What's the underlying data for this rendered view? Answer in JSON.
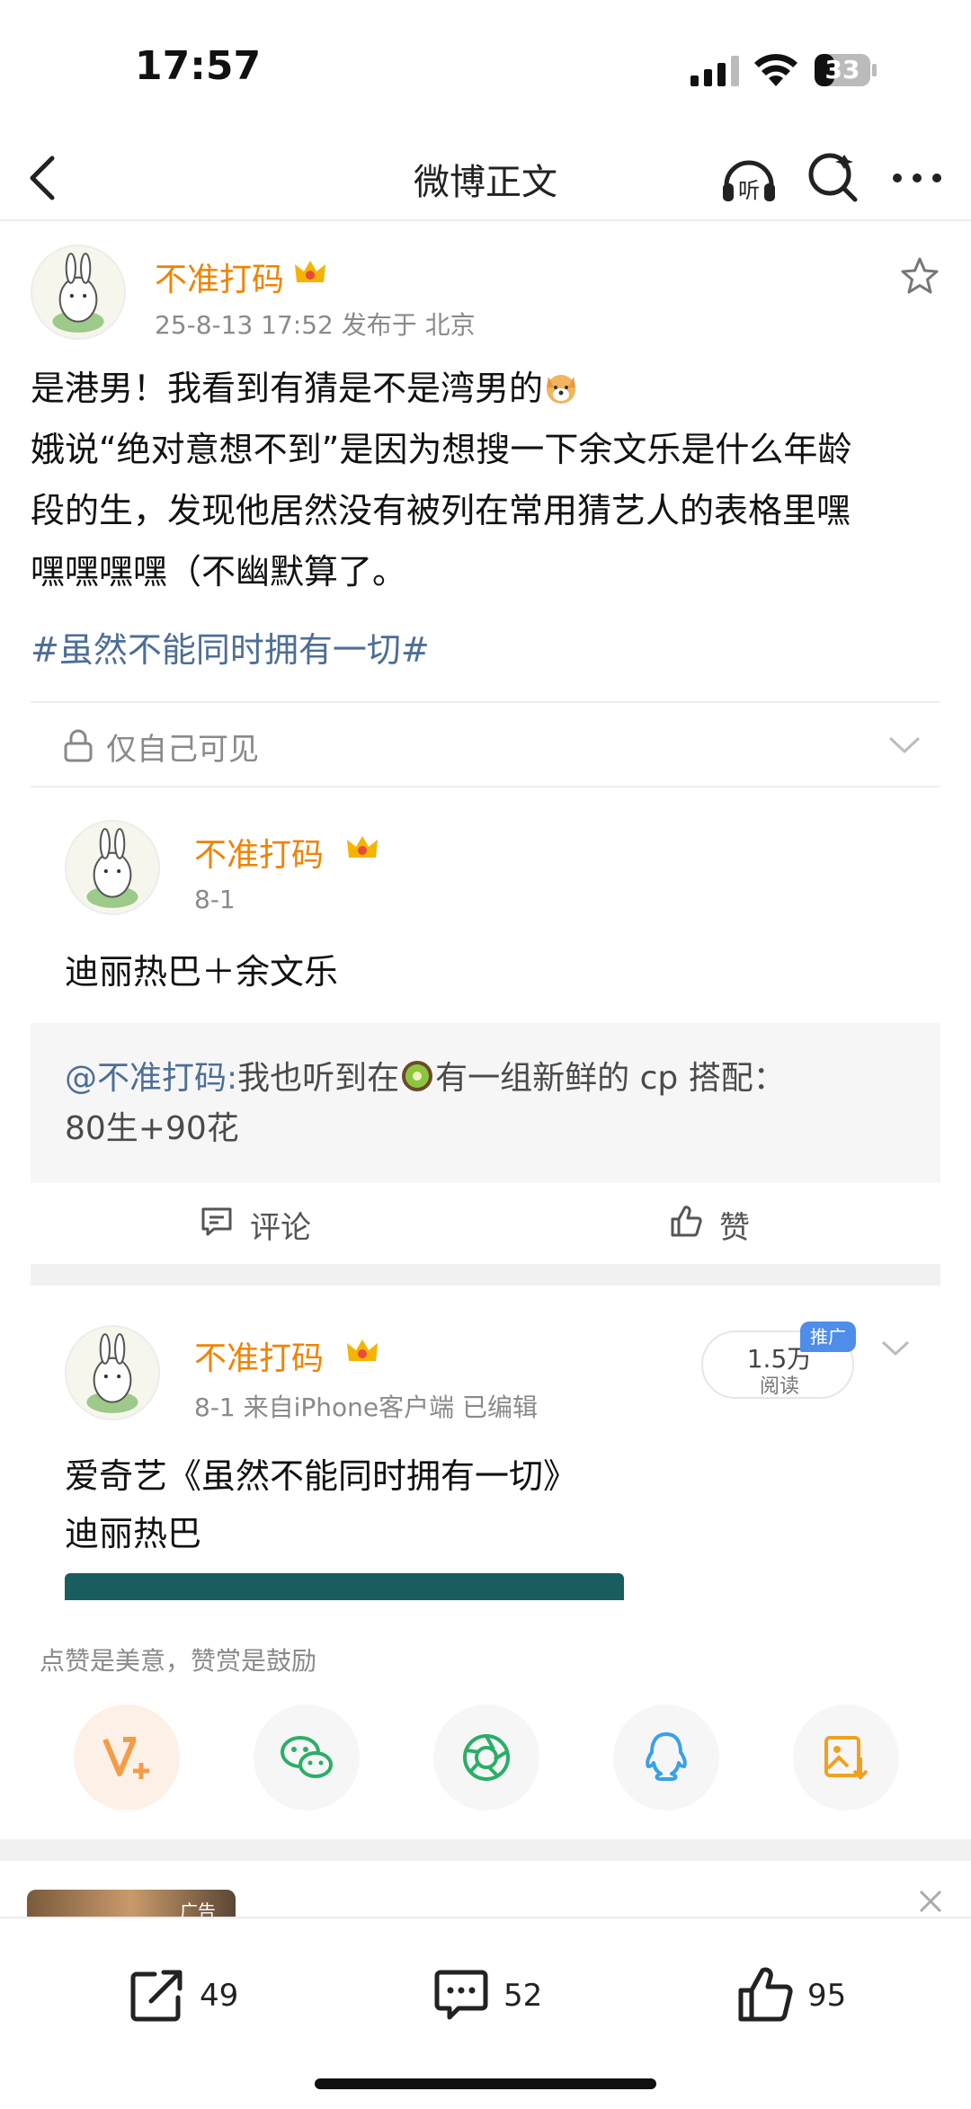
{
  "status_bar": {
    "time": "17:57",
    "battery": "33"
  },
  "nav": {
    "title": "微博正文"
  },
  "post": {
    "author": "不准打码",
    "meta": "25-8-13 17:52  发布于 北京",
    "lines": [
      "是港男！我看到有猜是不是湾男的",
      "娥说“绝对意想不到”是因为想搜一下余文乐是什么年龄",
      "段的生，发现他居然没有被列在常用猜艺人的表格里嘿",
      "嘿嘿嘿嘿（不幽默算了。"
    ],
    "hashtag": "#虽然不能同时拥有一切#",
    "privacy": "仅自己可见"
  },
  "comment": {
    "author": "不准打码",
    "date": "8-1",
    "text": "迪丽热巴＋余文乐",
    "quote_mention": "@不准打码:",
    "quote_part1": "我也听到在",
    "quote_part2": "有一组新鲜的 cp 搭配：",
    "quote_line2": "80生+90花",
    "comment_label": "评论",
    "like_label": "赞"
  },
  "post2": {
    "author": "不准打码",
    "meta": "8-1  来自iPhone客户端  已编辑",
    "read_count": "1.5万",
    "read_label": "阅读",
    "promo": "推广",
    "line1": "爱奇艺《虽然不能同时拥有一切》",
    "line2": "迪丽热巴"
  },
  "reward": {
    "tip": "点赞是美意，赞赏是鼓励"
  },
  "ad": {
    "label": "广告"
  },
  "toolbar": {
    "share_count": "49",
    "comment_count": "52",
    "like_count": "95"
  },
  "colors": {
    "username": "#f08300",
    "link": "#4d6e96"
  }
}
